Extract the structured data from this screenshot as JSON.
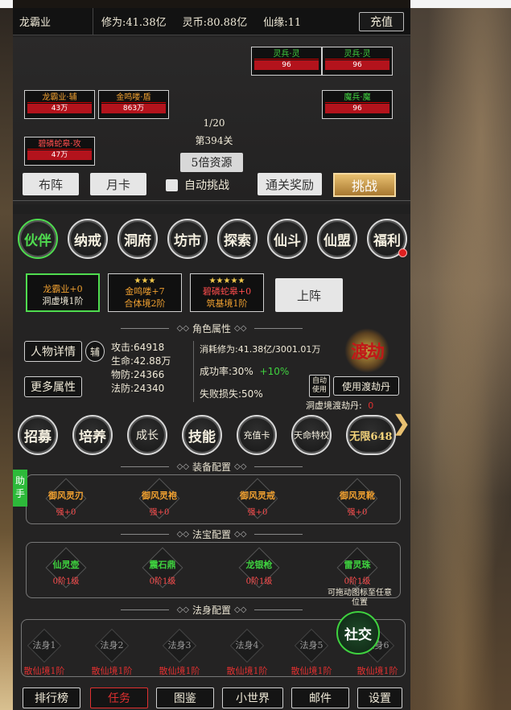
{
  "header": {
    "player_name": "龙霸业",
    "cultivation": "修为:41.38亿",
    "spirit_coin": "灵币:80.88亿",
    "fate": "仙缘:11",
    "recharge": "充值"
  },
  "battle": {
    "allies": [
      {
        "name": "龙霸业·辅",
        "hp": "43万",
        "color": "orange"
      },
      {
        "name": "金鸣喽·盾",
        "hp": "863万",
        "color": "orange"
      },
      {
        "name": "碧磷蛇皋·攻",
        "hp": "47万",
        "color": "red"
      }
    ],
    "enemies": [
      {
        "name": "灵兵·灵",
        "hp": "96",
        "color": "green"
      },
      {
        "name": "灵兵·灵",
        "hp": "96",
        "color": "green"
      },
      {
        "name": "魔兵·魔",
        "hp": "96",
        "color": "green"
      }
    ],
    "wave": "1/20",
    "level": "第394关",
    "resource_button": "5倍资源",
    "formation": "布阵",
    "monthly_card": "月卡",
    "auto_challenge": "自动挑战",
    "clear_reward": "通关奖励",
    "challenge": "挑战"
  },
  "nav_circles": [
    {
      "label": "伙伴",
      "active": true
    },
    {
      "label": "纳戒"
    },
    {
      "label": "洞府"
    },
    {
      "label": "坊市"
    },
    {
      "label": "探索"
    },
    {
      "label": "仙斗"
    },
    {
      "label": "仙盟"
    },
    {
      "label": "福利",
      "badge": true
    }
  ],
  "team": [
    {
      "stars": "",
      "line1": "龙霸业+0",
      "line2": "洞虚境1阶",
      "color": "orange"
    },
    {
      "stars": "★★★",
      "line1": "金鸣喽+7",
      "line2": "合体境2阶",
      "color": "orange"
    },
    {
      "stars": "★★★★★",
      "line1": "碧磷蛇皋+0",
      "line2": "筑基境1阶",
      "color": "red"
    }
  ],
  "deploy": "上阵",
  "sections": {
    "attributes": "角色属性",
    "equipment": "装备配置",
    "treasure": "法宝配置",
    "body": "法身配置"
  },
  "attrs": {
    "detail_btn": "人物详情",
    "assist": "辅",
    "more_btn": "更多属性",
    "attack": "攻击:64918",
    "life": "生命:42.88万",
    "pdef": "物防:24366",
    "mdef": "法防:24340",
    "consume": "消耗修为:41.38亿/3001.01万",
    "success": "成功率:30%",
    "success_bonus": "+10%",
    "fail_loss": "失败损失:50%",
    "auto_use": "自动使用",
    "use_pill": "使用渡劫丹",
    "pill_label": "洞虚境渡劫丹:",
    "pill_count": "0",
    "tribulation_logo": "渡劫"
  },
  "action_circles": [
    "招募",
    "培养",
    "成长",
    "技能",
    "充值卡",
    "天命特权",
    "无限648"
  ],
  "equipment": [
    {
      "name": "御风灵刃",
      "level": "强+0"
    },
    {
      "name": "御风灵袍",
      "level": "强+0"
    },
    {
      "name": "御风灵戒",
      "level": "强+0"
    },
    {
      "name": "御风灵靴",
      "level": "强+0"
    }
  ],
  "treasure": [
    {
      "name": "仙灵壶",
      "level": "0阶1级"
    },
    {
      "name": "震石鼎",
      "level": "0阶1级"
    },
    {
      "name": "龙银枪",
      "level": "0阶1级"
    },
    {
      "name": "雷灵珠",
      "level": "0阶1级"
    }
  ],
  "bodies": [
    {
      "name": "法身1",
      "level": "散仙境1阶"
    },
    {
      "name": "法身2",
      "level": "散仙境1阶"
    },
    {
      "name": "法身3",
      "level": "散仙境1阶"
    },
    {
      "name": "法身4",
      "level": "散仙境1阶"
    },
    {
      "name": "法身5",
      "level": "散仙境1阶"
    },
    {
      "name": "法身6",
      "level": "散仙境1阶"
    }
  ],
  "helper": "助手",
  "drag_hint": "可拖动图标至任意位置",
  "social": "社交",
  "bottom_nav": [
    "排行榜",
    "任务",
    "图鉴",
    "小世界",
    "邮件",
    "设置"
  ]
}
